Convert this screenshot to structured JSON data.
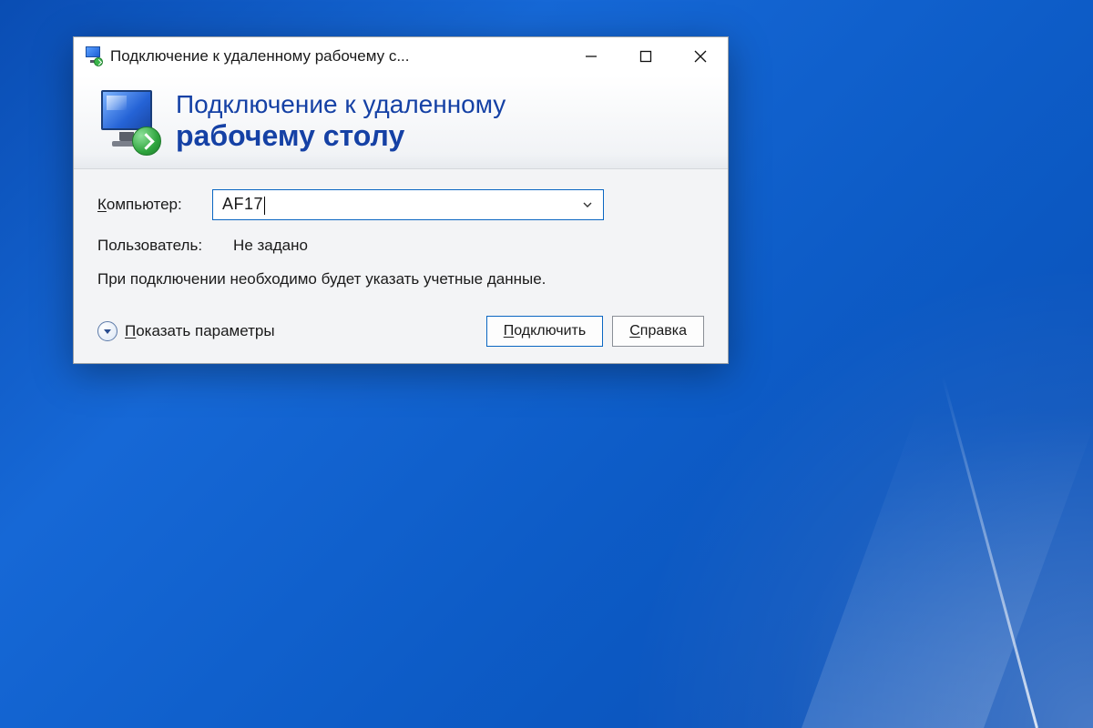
{
  "window": {
    "title": "Подключение к удаленному рабочему с..."
  },
  "banner": {
    "line1": "Подключение к удаленному",
    "line2": "рабочему столу"
  },
  "form": {
    "computer_label_first": "К",
    "computer_label_rest": "омпьютер:",
    "computer_value": "AF17",
    "user_label": "Пользователь:",
    "user_value": "Не задано",
    "hint": "При подключении необходимо будет указать учетные данные."
  },
  "footer": {
    "show_options_first": "П",
    "show_options_rest": "оказать параметры",
    "connect_first": "П",
    "connect_rest": "одключить",
    "help_first": "С",
    "help_rest": "правка"
  }
}
